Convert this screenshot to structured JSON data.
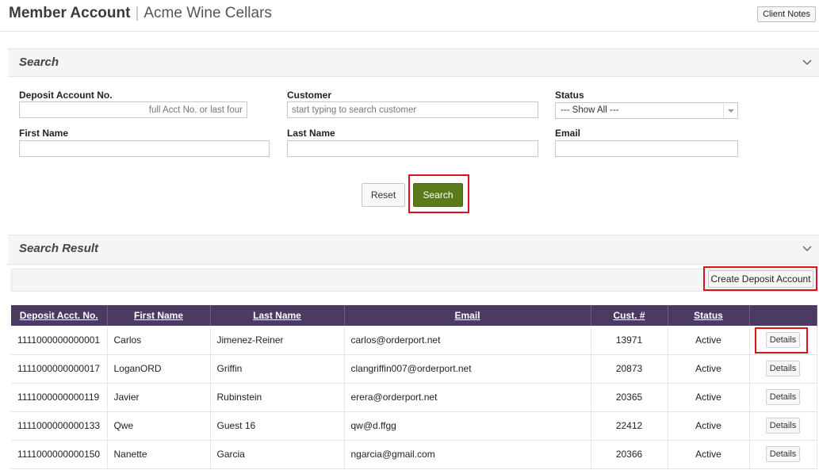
{
  "header": {
    "title": "Member Account",
    "separator": "|",
    "subtitle": "Acme Wine Cellars",
    "client_notes_label": "Client Notes"
  },
  "search_panel": {
    "title": "Search",
    "fields": {
      "deposit_account_label": "Deposit Account No.",
      "deposit_account_placeholder": "full Acct No. or last four",
      "customer_label": "Customer",
      "customer_placeholder": "start typing to search customer",
      "status_label": "Status",
      "status_value": "--- Show All ---",
      "first_name_label": "First Name",
      "last_name_label": "Last Name",
      "email_label": "Email"
    },
    "reset_label": "Reset",
    "search_label": "Search"
  },
  "results_panel": {
    "title": "Search Result",
    "create_label": "Create Deposit Account",
    "columns": [
      "Deposit Acct. No.",
      "First Name",
      "Last Name",
      "Email",
      "Cust. #",
      "Status",
      ""
    ],
    "details_label": "Details",
    "rows": [
      {
        "acct": "1111000000000001",
        "first": "Carlos",
        "last": "Jimenez-Reiner",
        "email": "carlos@orderport.net",
        "cust": "13971",
        "status": "Active"
      },
      {
        "acct": "1111000000000017",
        "first": "LoganORD",
        "last": "Griffin",
        "email": "clangriffin007@orderport.net",
        "cust": "20873",
        "status": "Active"
      },
      {
        "acct": "1111000000000119",
        "first": "Javier",
        "last": "Rubinstein",
        "email": "erera@orderport.net",
        "cust": "20365",
        "status": "Active"
      },
      {
        "acct": "1111000000000133",
        "first": "Qwe",
        "last": "Guest 16",
        "email": "qw@d.ffgg",
        "cust": "22412",
        "status": "Active"
      },
      {
        "acct": "1111000000000150",
        "first": "Nanette",
        "last": "Garcia",
        "email": "ngarcia@gmail.com",
        "cust": "20366",
        "status": "Active"
      }
    ]
  },
  "colors": {
    "header_bg": "#4b3a62",
    "search_button": "#5b7a1a",
    "highlight": "#d9121b"
  },
  "icons": {
    "panel_toggle": "chevron-down-icon",
    "select_arrow": "caret-down-icon"
  }
}
